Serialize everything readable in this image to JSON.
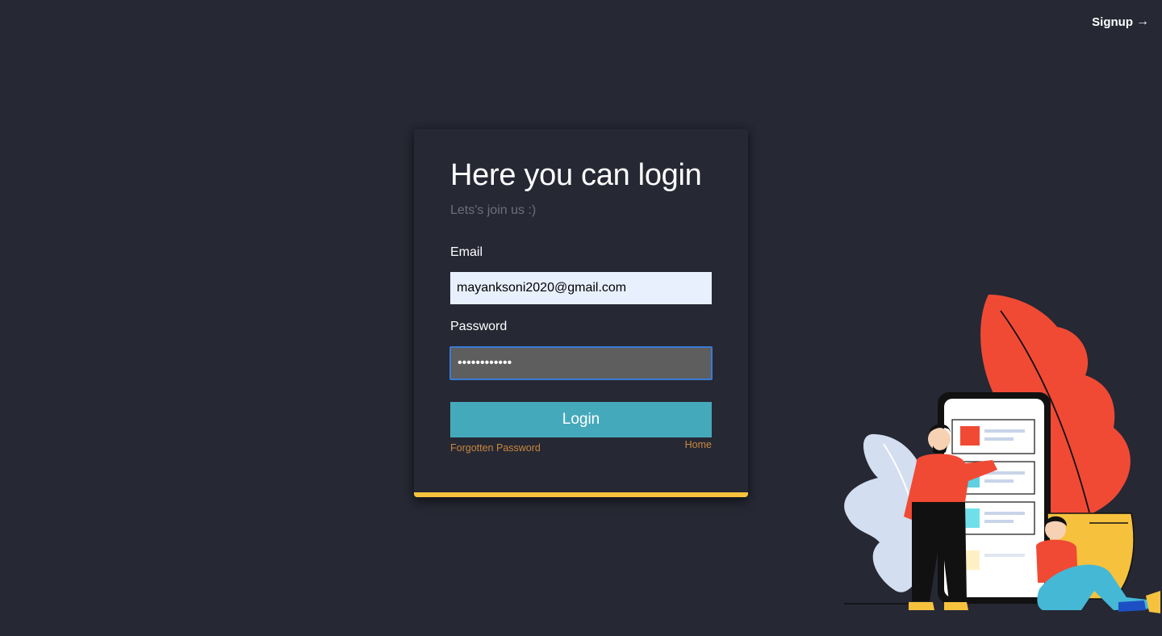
{
  "header": {
    "signup_label": "Signup",
    "signup_arrow": "→"
  },
  "login": {
    "title": "Here you can login",
    "subtitle": "Lets's join us :)",
    "email_label": "Email",
    "email_value": "mayanksoni2020@gmail.com",
    "password_label": "Password",
    "password_value": "••••••••••••",
    "submit_label": "Login",
    "forgot_label": "Forgotten Password",
    "home_label": "Home"
  },
  "colors": {
    "background": "#262834",
    "accent_border": "#f6c23e",
    "button": "#45a9bc",
    "link": "#c8873e"
  },
  "illustration": {
    "description_icon": "people-with-phone-and-plant-illustration"
  }
}
